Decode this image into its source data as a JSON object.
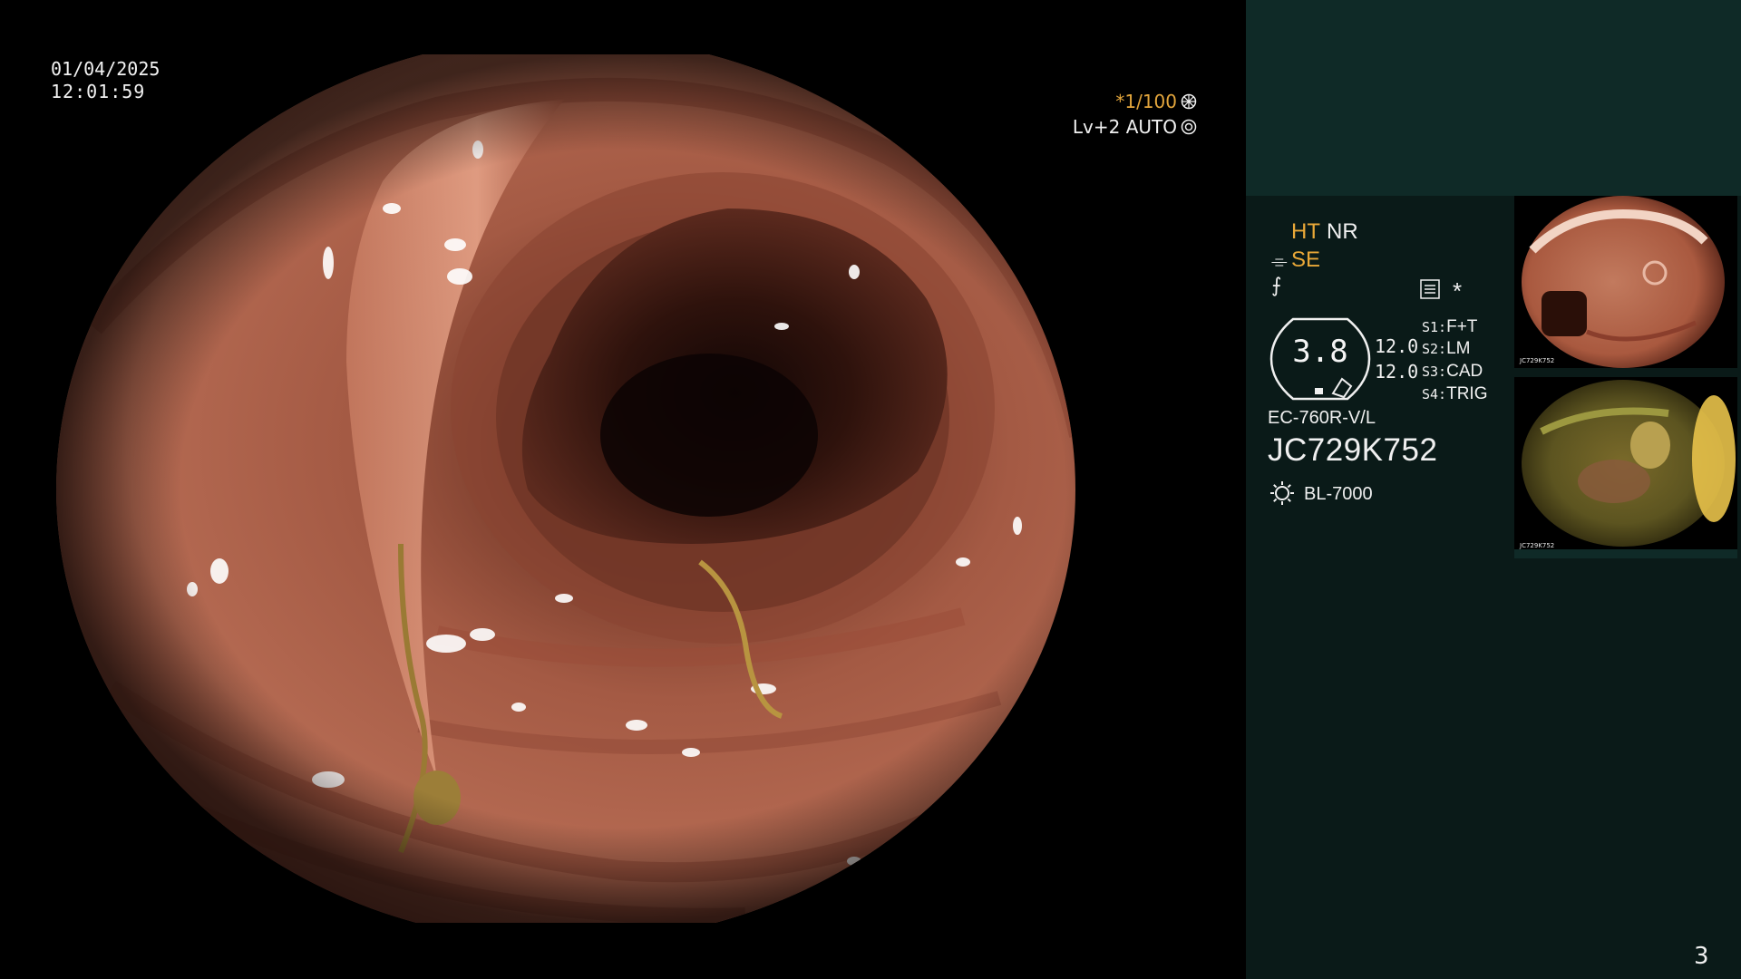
{
  "header": {
    "date": "01/04/2025",
    "time": "12:01:59",
    "zoom": "*1/100",
    "level": "Lv+2 AUTO"
  },
  "panel": {
    "ht": "HT",
    "nr": "NR",
    "se": "SE",
    "se_symbol": "⌯",
    "hook_symbol": "⨍",
    "star": "*",
    "gauge_value": "3.8",
    "value_1": "12.0",
    "value_2": "12.0",
    "switches": [
      {
        "key": "S1:",
        "value": "F+T"
      },
      {
        "key": "S2:",
        "value": "LM"
      },
      {
        "key": "S3:",
        "value": "CAD"
      },
      {
        "key": "S4:",
        "value": "TRIG"
      }
    ],
    "scope_model": "EC-760R-V/L",
    "scope_serial": "JC729K752",
    "light_source": "BL-7000"
  },
  "thumbnails": [
    {
      "serial": "JC729K752"
    },
    {
      "serial": "JC729K752"
    }
  ],
  "page_number": "3",
  "colors": {
    "panel_bg": "#0a1a18",
    "panel_top": "#0f2a27",
    "accent_orange": "#e9a838",
    "text": "#f0f0f0"
  }
}
